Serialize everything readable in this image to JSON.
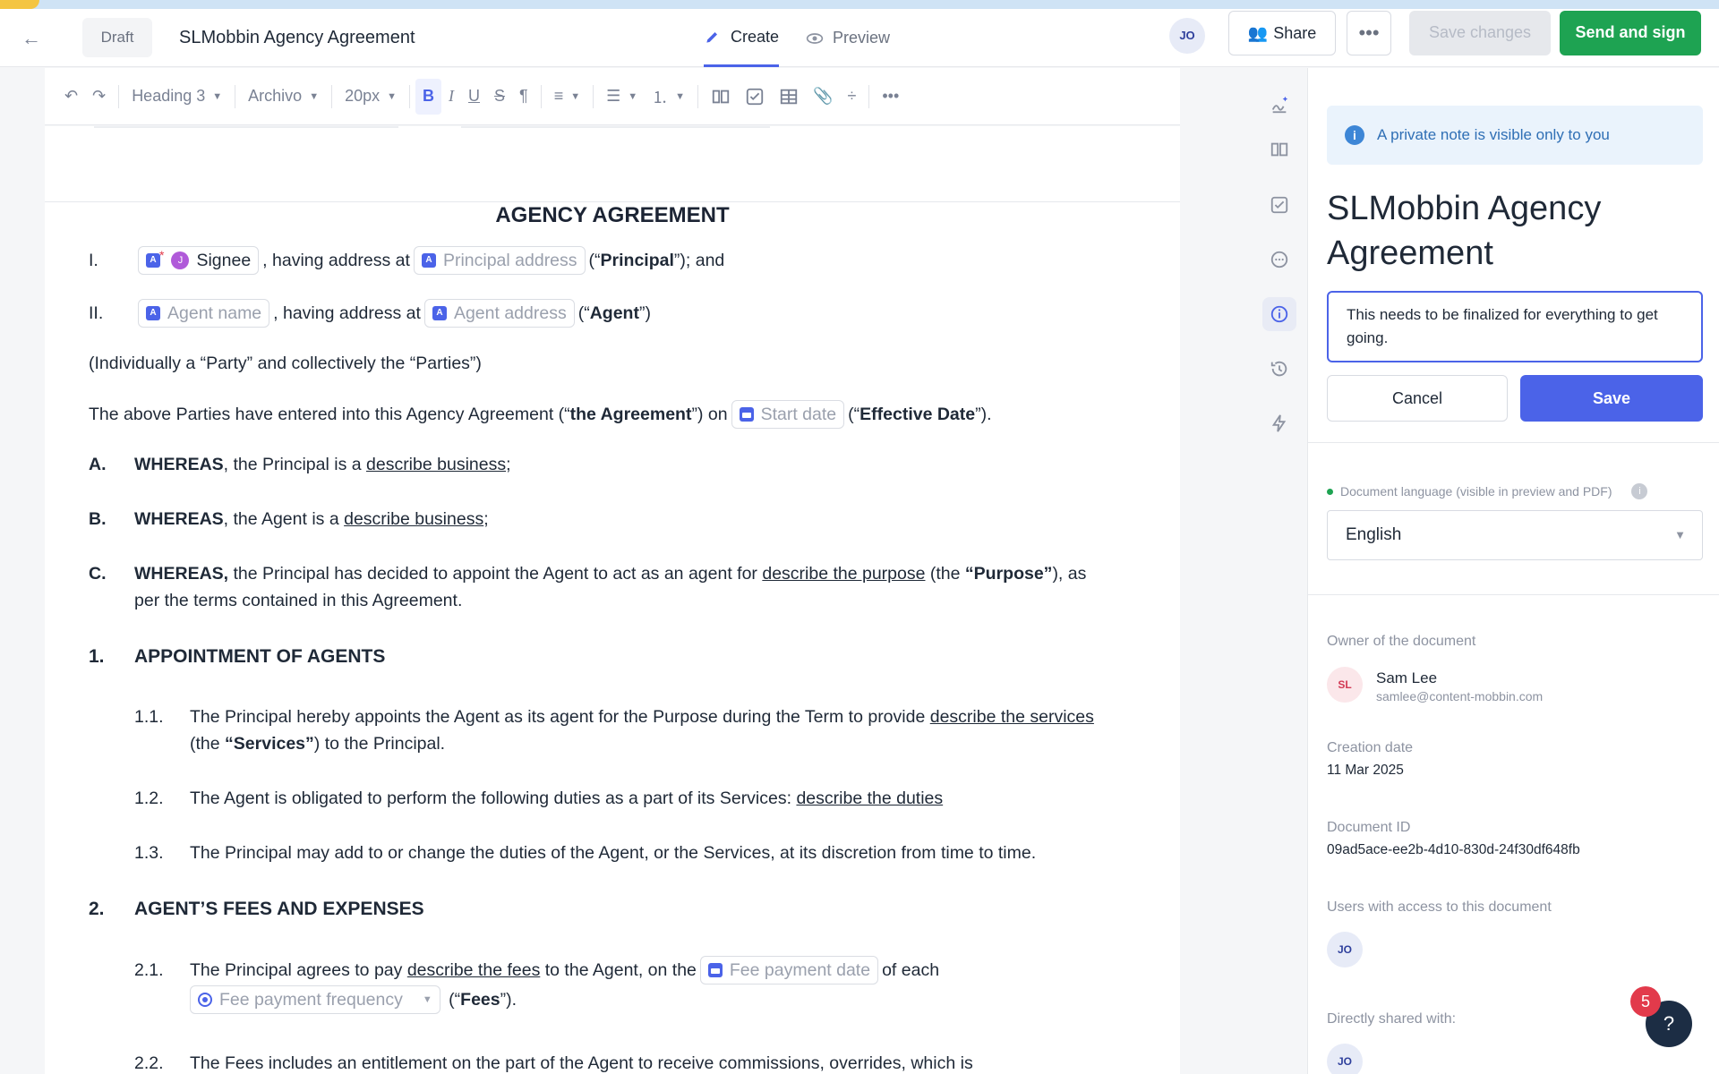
{
  "header": {
    "draft_label": "Draft",
    "title": "SLMobbin Agency Agreement",
    "tabs": [
      {
        "label": "Create"
      },
      {
        "label": "Preview"
      }
    ],
    "user_initials": "JO",
    "share_label": "Share",
    "more_label": "•••",
    "save_changes_label": "Save changes",
    "send_sign_label": "Send and sign"
  },
  "toolbar": {
    "block_style": "Heading 3",
    "font": "Archivo",
    "font_size": "20px",
    "more_label": "•••"
  },
  "document": {
    "heading": "AGENCY AGREEMENT",
    "party1": {
      "num": "I.",
      "signee_chip": "Signee",
      "signee_initial": "J",
      "text1": ", having address at",
      "address_chip": "Principal address",
      "text2a": " (“",
      "text2b": "Principal",
      "text2c": "”); and"
    },
    "party2": {
      "num": "II.",
      "name_chip": "Agent name",
      "text1": ", having address at",
      "address_chip": "Agent address",
      "text2a": " (“",
      "text2b": "Agent",
      "text2c": "”)"
    },
    "collective": "(Individually a “Party” and collectively the “Parties”)",
    "entered": {
      "a": "The above Parties have entered into this Agency Agreement (“",
      "b": "the Agreement",
      "c": "”) on",
      "chip": "Start date",
      "d": " (“",
      "e": "Effective Date",
      "f": "”)."
    },
    "whereas_a": {
      "letter": "A.",
      "bold": "WHEREAS",
      "text": ", the Principal is a ",
      "link": "describe business",
      "end": ";"
    },
    "whereas_b": {
      "letter": "B.",
      "bold": "WHEREAS",
      "text": ", the Agent is a ",
      "link": "describe business",
      "end": ";"
    },
    "whereas_c": {
      "letter": "C.",
      "bold": "WHEREAS,",
      "text": " the Principal has decided to appoint the Agent to act as an agent for ",
      "link": "describe the purpose",
      "t2": " (the ",
      "b2": "“Purpose”",
      "t3": "), as",
      "line2": "per the terms contained in this Agreement."
    },
    "sec1": {
      "num": "1.",
      "title": "APPOINTMENT OF AGENTS"
    },
    "s11": {
      "num": "1.1.",
      "text": "The Principal hereby appoints the Agent as its agent for the Purpose during the Term to provide ",
      "link": "describe the services",
      "l2a": "(the ",
      "l2b": "“Services”",
      "l2c": ") to the Principal."
    },
    "s12": {
      "num": "1.2.",
      "text": "The Agent is obligated to perform the following duties as a part of its Services: ",
      "link": "describe the duties"
    },
    "s13": {
      "num": "1.3.",
      "text": "The Principal may add to or change the duties of the Agent, or the Services, at its discretion from time to time."
    },
    "sec2": {
      "num": "2.",
      "title": "AGENT’S FEES AND EXPENSES"
    },
    "s21": {
      "num": "2.1.",
      "text": "The Principal agrees to pay ",
      "link": "describe the fees",
      "t2": " to the Agent, on the",
      "chip": "Fee payment date",
      "t3": "of each",
      "chip2": "Fee payment frequency",
      "t4a": " (“",
      "t4b": "Fees",
      "t4c": "”)."
    },
    "s22": {
      "num": "2.2.",
      "text": "The Fees includes an entitlement on the part of the Agent to receive commissions, overrides, which is"
    }
  },
  "panel": {
    "private_note": "A private note is visible only to you",
    "title": "SLMobbin Agency Agreement",
    "note_value": "This needs to be finalized for everything to get going.",
    "cancel_label": "Cancel",
    "save_label": "Save",
    "lang_label": "Document language (visible in preview and PDF)",
    "lang_value": "English",
    "owner_label": "Owner of the document",
    "owner_initials": "SL",
    "owner_name": "Sam Lee",
    "owner_email": "samlee@content-mobbin.com",
    "creation_label": "Creation date",
    "creation_value": "11 Mar 2025",
    "docid_label": "Document ID",
    "docid_value": "09ad5ace-ee2b-4d10-830d-24f30df648fb",
    "access_label": "Users with access to this document",
    "access_user": "JO",
    "shared_label": "Directly shared with:",
    "shared_user": "JO"
  },
  "help": {
    "label": "?",
    "badge": "5"
  },
  "colors": {
    "accent": "#4b63e8",
    "send": "#1ea352",
    "badge": "#e23a4b"
  }
}
